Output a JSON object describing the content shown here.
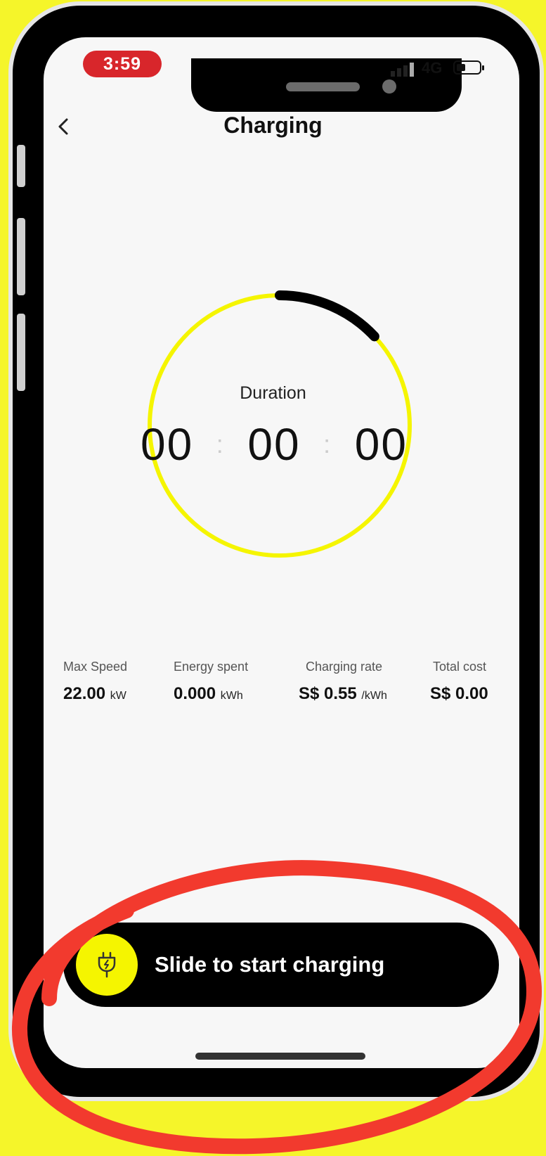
{
  "status_bar": {
    "time": "3:59",
    "network": "4G"
  },
  "header": {
    "title": "Charging",
    "back_icon": "chevron-left-icon"
  },
  "timer": {
    "label": "Duration",
    "hours": "00",
    "minutes": "00",
    "seconds": "00",
    "progress_arc_fraction": 0.13
  },
  "stats": {
    "max_speed": {
      "label": "Max Speed",
      "value": "22.00",
      "unit": "kW"
    },
    "energy_spent": {
      "label": "Energy spent",
      "value": "0.000",
      "unit": "kWh"
    },
    "charging_rate": {
      "label": "Charging rate",
      "value": "S$ 0.55",
      "unit": "/kWh"
    },
    "total_cost": {
      "label": "Total cost",
      "value": "S$ 0.00",
      "unit": ""
    }
  },
  "slider": {
    "label": "Slide to start charging",
    "icon": "plug-charging-icon"
  },
  "colors": {
    "accent_yellow": "#f5f500",
    "annotation_red": "#f23a2e",
    "time_pill_red": "#d8262b"
  }
}
